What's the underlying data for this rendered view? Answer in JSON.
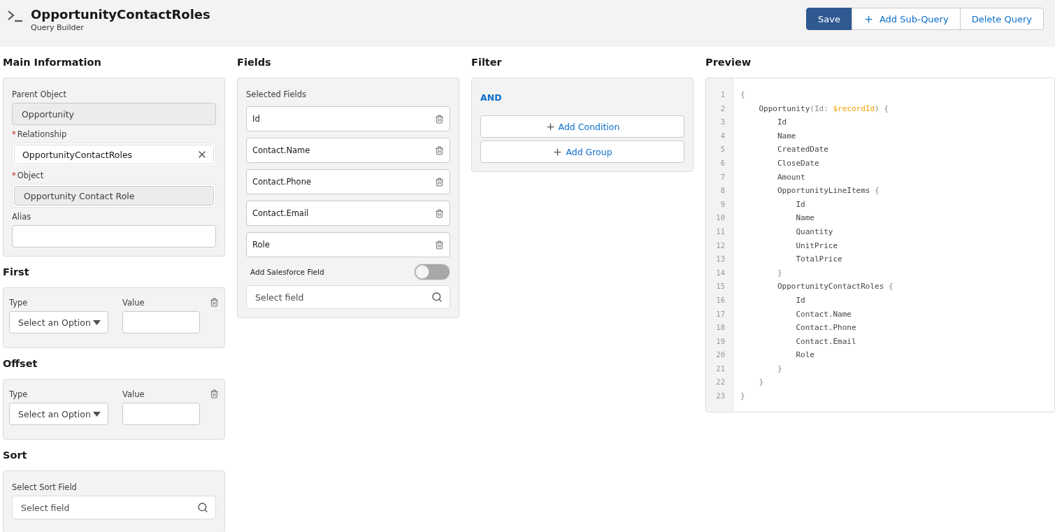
{
  "header": {
    "title": "OpportunityContactRoles",
    "subtitle": "Query Builder",
    "buttons": [
      {
        "label": "Save",
        "kind": "primary"
      },
      {
        "label": "Add Sub-Query",
        "kind": "add"
      },
      {
        "label": "Delete Query",
        "kind": "plain"
      }
    ]
  },
  "main_information": {
    "heading": "Main Information",
    "fields": [
      {
        "label": "Parent Object",
        "value": "Opportunity",
        "kind": "readonly"
      },
      {
        "label": "Relationship",
        "required_mark": "*",
        "value": "OpportunityContactRoles",
        "kind": "clearable"
      },
      {
        "label": "Object",
        "required_mark": "*",
        "value": "Opportunity Contact Role",
        "kind": "readonly"
      },
      {
        "label": "Alias",
        "kind": "text"
      }
    ]
  },
  "first": {
    "heading": "First",
    "type_label": "Type",
    "type_placeholder": "Select an Option",
    "value_label": "Value"
  },
  "offset": {
    "heading": "Offset",
    "type_label": "Type",
    "type_placeholder": "Select an Option",
    "value_label": "Value"
  },
  "sort": {
    "heading": "Sort",
    "label": "Select Sort Field",
    "placeholder": "Select field"
  },
  "fields": {
    "heading": "Fields",
    "label": "Selected Fields",
    "items": [
      "Id",
      "Contact.Name",
      "Contact.Phone",
      "Contact.Email",
      "Role"
    ],
    "toggle": {
      "label": "Add Salesforce Field",
      "on": false
    },
    "search_placeholder": "Select field"
  },
  "filter": {
    "heading": "Filter",
    "operator": "AND",
    "buttons": [
      "Add Condition",
      "Add Group"
    ]
  },
  "preview": {
    "heading": "Preview",
    "lines": [
      {
        "number": "1",
        "parts": [
          {
            "text": "{",
            "kind": "punct"
          }
        ]
      },
      {
        "number": "2",
        "parts": [
          {
            "text": "    Opportunity",
            "kind": "name"
          },
          {
            "text": "(Id: ",
            "kind": "punct"
          },
          {
            "text": "$recordId",
            "kind": "variable"
          },
          {
            "text": ") {",
            "kind": "punct"
          }
        ]
      },
      {
        "number": "3",
        "parts": [
          {
            "text": "        Id",
            "kind": "name"
          }
        ]
      },
      {
        "number": "4",
        "parts": [
          {
            "text": "        Name",
            "kind": "name"
          }
        ]
      },
      {
        "number": "5",
        "parts": [
          {
            "text": "        CreatedDate",
            "kind": "name"
          }
        ]
      },
      {
        "number": "6",
        "parts": [
          {
            "text": "        CloseDate",
            "kind": "name"
          }
        ]
      },
      {
        "number": "7",
        "parts": [
          {
            "text": "        Amount",
            "kind": "name"
          }
        ]
      },
      {
        "number": "8",
        "parts": [
          {
            "text": "        OpportunityLineItems",
            "kind": "name"
          },
          {
            "text": " {",
            "kind": "punct"
          }
        ]
      },
      {
        "number": "9",
        "parts": [
          {
            "text": "            Id",
            "kind": "name"
          }
        ]
      },
      {
        "number": "10",
        "parts": [
          {
            "text": "            Name",
            "kind": "name"
          }
        ]
      },
      {
        "number": "11",
        "parts": [
          {
            "text": "            Quantity",
            "kind": "name"
          }
        ]
      },
      {
        "number": "12",
        "parts": [
          {
            "text": "            UnitPrice",
            "kind": "name"
          }
        ]
      },
      {
        "number": "13",
        "parts": [
          {
            "text": "            TotalPrice",
            "kind": "name"
          }
        ]
      },
      {
        "number": "14",
        "parts": [
          {
            "text": "        }",
            "kind": "punct"
          }
        ]
      },
      {
        "number": "15",
        "parts": [
          {
            "text": "        OpportunityContactRoles",
            "kind": "name"
          },
          {
            "text": " {",
            "kind": "punct"
          }
        ]
      },
      {
        "number": "16",
        "parts": [
          {
            "text": "            Id",
            "kind": "name"
          }
        ]
      },
      {
        "number": "17",
        "parts": [
          {
            "text": "            Contact.Name",
            "kind": "name"
          }
        ]
      },
      {
        "number": "18",
        "parts": [
          {
            "text": "            Contact.Phone",
            "kind": "name"
          }
        ]
      },
      {
        "number": "19",
        "parts": [
          {
            "text": "            Contact.Email",
            "kind": "name"
          }
        ]
      },
      {
        "number": "20",
        "parts": [
          {
            "text": "            Role",
            "kind": "name"
          }
        ]
      },
      {
        "number": "21",
        "parts": [
          {
            "text": "        }",
            "kind": "punct"
          }
        ]
      },
      {
        "number": "22",
        "parts": [
          {
            "text": "    }",
            "kind": "punct"
          }
        ]
      },
      {
        "number": "23",
        "parts": [
          {
            "text": "}",
            "kind": "punct"
          }
        ]
      }
    ]
  }
}
